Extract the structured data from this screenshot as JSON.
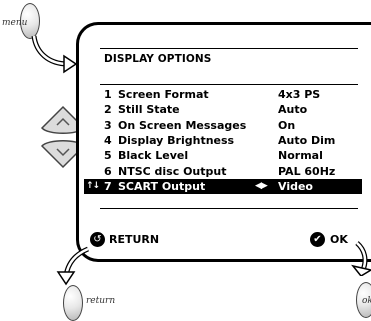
{
  "remote": {
    "menu_label": "menu",
    "return_label": "return",
    "ok_label": "ok"
  },
  "screen": {
    "title": "DISPLAY OPTIONS",
    "rows": [
      {
        "num": "1",
        "label": "Screen Format",
        "value": "4x3 PS"
      },
      {
        "num": "2",
        "label": "Still State",
        "value": "Auto"
      },
      {
        "num": "3",
        "label": "On Screen Messages",
        "value": "On"
      },
      {
        "num": "4",
        "label": "Display Brightness",
        "value": "Auto Dim"
      },
      {
        "num": "5",
        "label": "Black Level",
        "value": "Normal"
      },
      {
        "num": "6",
        "label": "NTSC disc Output",
        "value": "PAL 60Hz"
      },
      {
        "num": "7",
        "label": "SCART Output",
        "value": "Video",
        "selected": true
      }
    ],
    "selected_row_markers": {
      "updown": "↑↓",
      "leftright": "◀▶"
    },
    "return_text": "RETURN",
    "ok_text": "OK"
  },
  "icons": {
    "return_icon": "return-arrow-icon",
    "ok_icon": "checkmark-icon",
    "nav_up": "chevron-up-icon",
    "nav_down": "chevron-down-icon"
  },
  "colors": {
    "highlight_bg": "#000000",
    "highlight_text": "#ffffff",
    "button_fill": "#e0e0e0"
  }
}
